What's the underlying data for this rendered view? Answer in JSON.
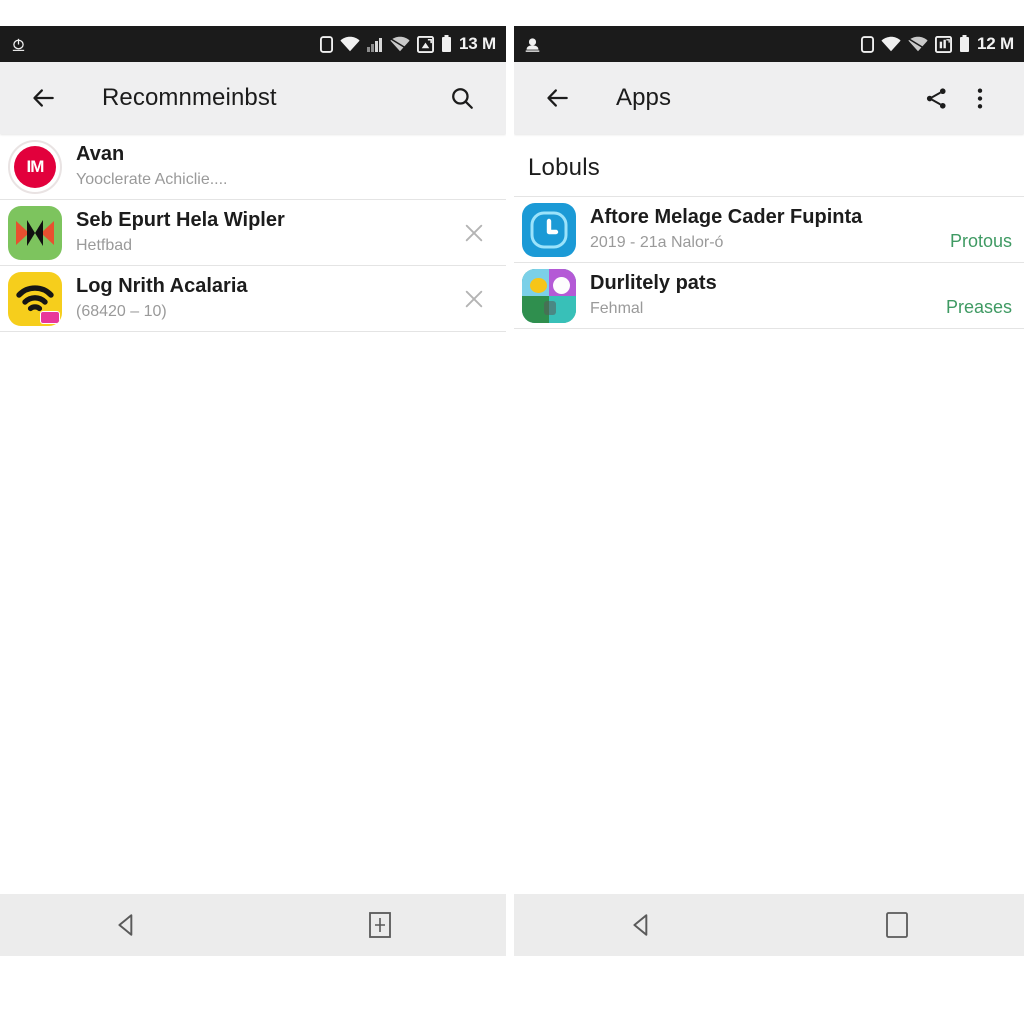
{
  "left_panel": {
    "status_bar": {
      "left_icon": "cast-icon",
      "icons": [
        "screen-rotation-icon",
        "wifi-full-icon",
        "signal-bars-icon",
        "wifi-secondary-icon",
        "sync-image-icon",
        "battery-full-icon"
      ],
      "clock": "13 M"
    },
    "app_bar": {
      "back_icon": "back-arrow-icon",
      "title": "Recomnmeinbst",
      "search_icon": "search-icon"
    },
    "rows": [
      {
        "icon": "avan-account-icon",
        "icon_style": "avan",
        "icon_text": "IM",
        "title": "Avan",
        "subtitle": "Yooclerate Achiclie....",
        "dismissible": false
      },
      {
        "icon": "seb-epurt-app-icon",
        "icon_style": "green",
        "title": "Seb Epurt Hela Wipler",
        "subtitle": "Hetfbad",
        "dismissible": true,
        "dismiss_icon": "close-icon"
      },
      {
        "icon": "log-nrith-app-icon",
        "icon_style": "yellow",
        "title": "Log Nrith Acalaria",
        "subtitle": "(68420 – 10)",
        "dismissible": true,
        "dismiss_icon": "close-icon"
      }
    ],
    "nav_bar": {
      "back_icon": "nav-back-triangle-icon",
      "right_icon": "nav-add-square-icon"
    }
  },
  "right_panel": {
    "status_bar": {
      "left_icon": "downloading-icon",
      "icons": [
        "screen-rotation-icon",
        "wifi-full-icon",
        "wifi-secondary-icon",
        "sync-image-icon",
        "battery-full-icon"
      ],
      "clock": "12 M"
    },
    "app_bar": {
      "back_icon": "back-arrow-icon",
      "title": "Apps",
      "share_icon": "share-icon",
      "overflow_icon": "more-vertical-icon"
    },
    "section_header": "Lobuls",
    "rows": [
      {
        "icon": "aftore-melage-app-icon",
        "icon_style": "blue",
        "title": "Aftore Melage Cader Fupinta",
        "subtitle": "2019 - 21a Nalor-ó",
        "action_label": "Protous"
      },
      {
        "icon": "durlitely-pats-app-icon",
        "icon_style": "photos",
        "title": "Durlitely pats",
        "subtitle": "Fehmal",
        "action_label": "Preases"
      }
    ],
    "nav_bar": {
      "back_icon": "nav-back-triangle-icon",
      "right_icon": "nav-overview-square-icon"
    }
  },
  "colors": {
    "status_bar_bg": "#1b1b1b",
    "app_bar_bg": "#efeff0",
    "action_green": "#3f9a63",
    "nav_bar_bg": "#ececec",
    "title_text": "#1c1c1c",
    "subtitle_text": "#9a9a9a"
  }
}
